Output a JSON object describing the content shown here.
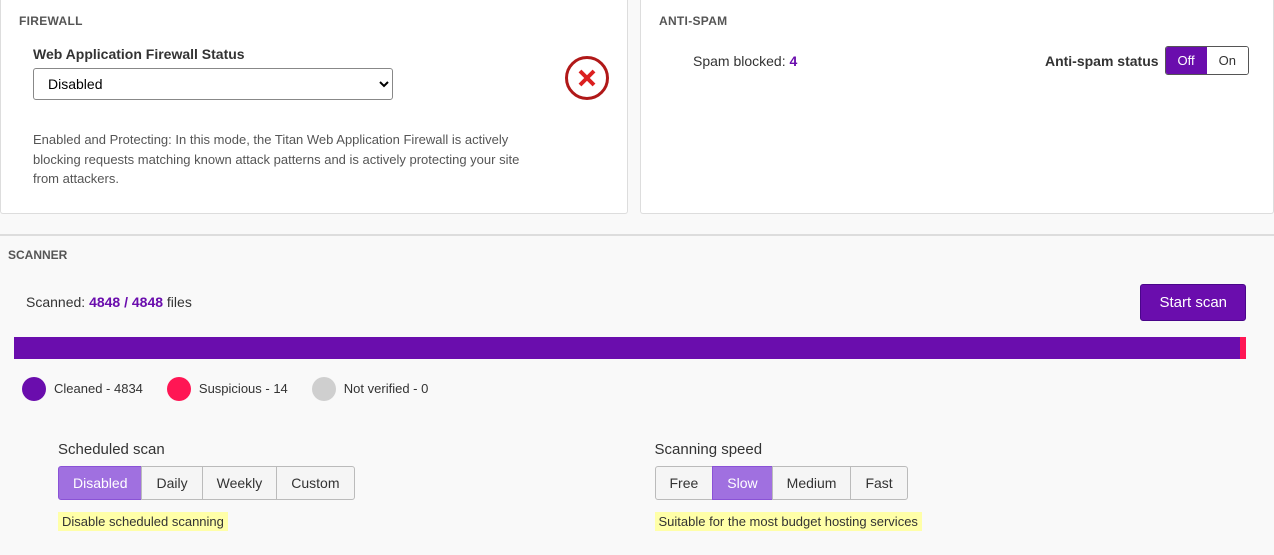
{
  "firewall": {
    "title": "FIREWALL",
    "status_label": "Web Application Firewall Status",
    "status_value": "Disabled",
    "description": "Enabled and Protecting: In this mode, the Titan Web Application Firewall is actively blocking requests matching known attack patterns and is actively protecting your site from attackers."
  },
  "antispam": {
    "title": "ANTI-SPAM",
    "blocked_label": "Spam blocked:",
    "blocked_count": "4",
    "status_label": "Anti-spam status",
    "off": "Off",
    "on": "On",
    "active": "off"
  },
  "scanner": {
    "title": "SCANNER",
    "scanned_label": "Scanned:",
    "scanned_value": "4848 / 4848",
    "scanned_suffix": "files",
    "start_button": "Start scan",
    "legend": {
      "cleaned": "Cleaned - 4834",
      "suspicious": "Suspicious - 14",
      "not_verified": "Not verified - 0"
    },
    "scheduled": {
      "title": "Scheduled scan",
      "options": [
        "Disabled",
        "Daily",
        "Weekly",
        "Custom"
      ],
      "active": "Disabled",
      "hint": "Disable scheduled scanning"
    },
    "speed": {
      "title": "Scanning speed",
      "options": [
        "Free",
        "Slow",
        "Medium",
        "Fast"
      ],
      "active": "Slow",
      "hint": "Suitable for the most budget hosting services"
    }
  }
}
